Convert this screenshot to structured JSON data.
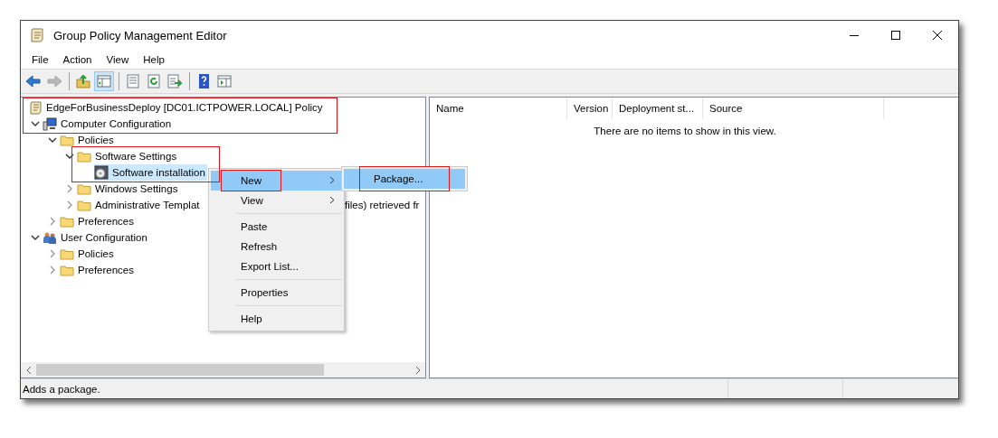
{
  "window": {
    "title": "Group Policy Management Editor"
  },
  "menu_bar": [
    "File",
    "Action",
    "View",
    "Help"
  ],
  "toolbar": [
    {
      "kind": "back",
      "disabled": false
    },
    {
      "kind": "forward",
      "disabled": true
    },
    {
      "kind": "separator"
    },
    {
      "kind": "up",
      "disabled": false
    },
    {
      "kind": "tree_toggle",
      "disabled": false,
      "pressed": true
    },
    {
      "kind": "separator"
    },
    {
      "kind": "properties",
      "disabled": false
    },
    {
      "kind": "refresh",
      "disabled": false
    },
    {
      "kind": "export",
      "disabled": false
    },
    {
      "kind": "separator"
    },
    {
      "kind": "help",
      "disabled": false
    },
    {
      "kind": "view",
      "disabled": false
    }
  ],
  "tree": [
    {
      "label": "EdgeForBusinessDeploy [DC01.ICTPOWER.LOCAL] Policy",
      "kind": "policy",
      "selected": false,
      "framed": true,
      "children": [
        {
          "label": "Computer Configuration",
          "kind": "computer",
          "expanded": true,
          "selected": false,
          "framed": true,
          "children": [
            {
              "label": "Policies",
              "kind": "folder",
              "expanded": true,
              "selected": false,
              "framed": false,
              "children": [
                {
                  "label": "Software Settings",
                  "kind": "folder",
                  "expanded": true,
                  "selected": false,
                  "framed": true,
                  "children": [
                    {
                      "label": "Software installation",
                      "kind": "software",
                      "selected": true,
                      "framed": true
                    }
                  ]
                },
                {
                  "label": "Windows Settings",
                  "kind": "folder",
                  "expanded": false,
                  "selected": false,
                  "framed": false
                },
                {
                  "label": "Administrative Templat",
                  "label_tail": "files) retrieved fr",
                  "kind": "folder",
                  "expanded": false,
                  "selected": false,
                  "framed": false
                }
              ]
            },
            {
              "label": "Preferences",
              "kind": "folder",
              "expanded": false,
              "selected": false,
              "framed": false
            }
          ]
        },
        {
          "label": "User Configuration",
          "kind": "users",
          "expanded": true,
          "selected": false,
          "framed": false,
          "children": [
            {
              "label": "Policies",
              "kind": "folder",
              "expanded": false,
              "selected": false,
              "framed": false
            },
            {
              "label": "Preferences",
              "kind": "folder",
              "expanded": false,
              "selected": false,
              "framed": false
            }
          ]
        }
      ]
    }
  ],
  "list": {
    "columns": [
      "Name",
      "Version",
      "Deployment st...",
      "Source"
    ],
    "empty_message": "There are no items to show in this view."
  },
  "context_menu": [
    {
      "kind": "item",
      "label": "New",
      "submenu": true,
      "selected": true,
      "framed": true
    },
    {
      "kind": "item",
      "label": "View",
      "submenu": true,
      "selected": false,
      "framed": false
    },
    {
      "kind": "separator"
    },
    {
      "kind": "item",
      "label": "Paste",
      "submenu": false,
      "selected": false,
      "framed": false
    },
    {
      "kind": "item",
      "label": "Refresh",
      "submenu": false,
      "selected": false,
      "framed": false
    },
    {
      "kind": "item",
      "label": "Export List...",
      "submenu": false,
      "selected": false,
      "framed": false
    },
    {
      "kind": "separator"
    },
    {
      "kind": "item",
      "label": "Properties",
      "submenu": false,
      "selected": false,
      "framed": false
    },
    {
      "kind": "separator"
    },
    {
      "kind": "item",
      "label": "Help",
      "submenu": false,
      "selected": false,
      "framed": false
    }
  ],
  "submenu": [
    {
      "label": "Package...",
      "selected": true,
      "framed": true
    }
  ],
  "status_bar": "Adds a package."
}
